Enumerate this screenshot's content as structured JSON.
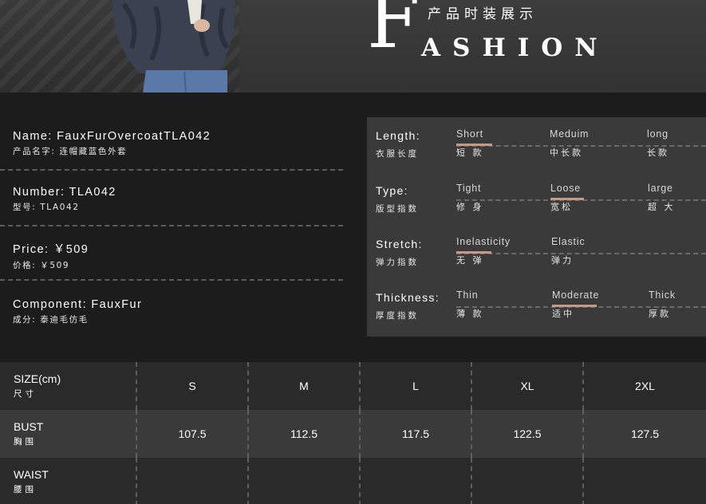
{
  "banner": {
    "cn_title": "产品时装展示",
    "big_letter": "F",
    "word_rest": "ASHION"
  },
  "product": {
    "name_line": "Name:  FauxFurOvercoatTLA042",
    "name_sub": "产品名字:   连帽藏蓝色外套",
    "number_line": "Number:  TLA042",
    "number_sub": "型号:  TLA042",
    "price_line": "Price:  ￥509",
    "price_sub": "价格: ￥509",
    "component_line": "Component:    FauxFur",
    "component_sub": "成分:   泰迪毛仿毛"
  },
  "attributes": [
    {
      "label": "Length:",
      "label_cn": "衣服长度",
      "options": [
        {
          "en": "Short",
          "cn": "短  款",
          "selected": true
        },
        {
          "en": "Meduim",
          "cn": "中长款",
          "selected": false
        },
        {
          "en": "long",
          "cn": "长款",
          "selected": false
        }
      ]
    },
    {
      "label": "Type:",
      "label_cn": "版型指数",
      "options": [
        {
          "en": "Tight",
          "cn": "修  身",
          "selected": false
        },
        {
          "en": "Loose",
          "cn": "宽松",
          "selected": true
        },
        {
          "en": "large",
          "cn": "超  大",
          "selected": false
        }
      ]
    },
    {
      "label": "Stretch:",
      "label_cn": "弹力指数",
      "options": [
        {
          "en": "Inelasticity",
          "cn": "无  弹",
          "selected": true
        },
        {
          "en": "Elastic",
          "cn": "弹力",
          "selected": false
        }
      ]
    },
    {
      "label": "Thickness:",
      "label_cn": "厚度指数",
      "options": [
        {
          "en": "Thin",
          "cn": "薄  款",
          "selected": false
        },
        {
          "en": "Moderate",
          "cn": "适中",
          "selected": true
        },
        {
          "en": "Thick",
          "cn": "厚款",
          "selected": false
        }
      ]
    }
  ],
  "size_table": {
    "header": {
      "en": "SIZE(cm)",
      "cn": "尺寸"
    },
    "sizes": [
      "S",
      "M",
      "L",
      "XL",
      "2XL"
    ],
    "rows": [
      {
        "en": "BUST",
        "cn": "胸围",
        "values": [
          "107.5",
          "112.5",
          "117.5",
          "122.5",
          "127.5"
        ]
      },
      {
        "en": "WAIST",
        "cn": "腰围",
        "values": [
          "",
          "",
          "",
          "",
          ""
        ]
      }
    ]
  },
  "colors": {
    "background": "#1c1c1c",
    "panel": "#3a3a3a",
    "accent_bar": "#c39a86"
  }
}
